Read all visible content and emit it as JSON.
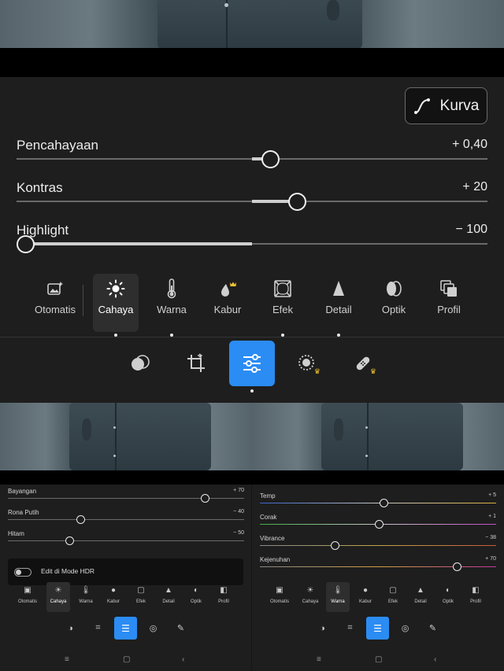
{
  "curve_button": {
    "label": "Kurva",
    "icon": "curve-icon"
  },
  "light_sliders": [
    {
      "label": "Pencahayaan",
      "value": "+ 0,40",
      "position": 0.54
    },
    {
      "label": "Kontras",
      "value": "+ 20",
      "position": 0.6
    },
    {
      "label": "Highlight",
      "value": "− 100",
      "position": 0.0
    }
  ],
  "edit_tabs": [
    {
      "label": "Otomatis",
      "icon": "auto-icon"
    },
    {
      "label": "Cahaya",
      "icon": "sun-icon",
      "active": true
    },
    {
      "label": "Warna",
      "icon": "thermometer-icon"
    },
    {
      "label": "Kabur",
      "icon": "blur-icon"
    },
    {
      "label": "Efek",
      "icon": "vignette-icon"
    },
    {
      "label": "Detail",
      "icon": "detail-icon"
    },
    {
      "label": "Optik",
      "icon": "lens-icon"
    },
    {
      "label": "Profil",
      "icon": "profile-icon"
    }
  ],
  "toolbar": [
    "presets-icon",
    "crop-icon",
    "adjust-icon",
    "masking-icon",
    "healing-icon"
  ],
  "mini_left": {
    "sliders": [
      {
        "label": "Bayangan",
        "value": "+ 70",
        "position": 0.83
      },
      {
        "label": "Rona Putih",
        "value": "− 40",
        "position": 0.3
      },
      {
        "label": "Hitam",
        "value": "− 50",
        "position": 0.25
      }
    ],
    "hdr_label": "Edit di Mode HDR",
    "active_tab": "Cahaya"
  },
  "mini_right": {
    "sliders": [
      {
        "label": "Temp",
        "value": "+ 5",
        "position": 0.52
      },
      {
        "label": "Corak",
        "value": "+ 1",
        "position": 0.5
      },
      {
        "label": "Vibrance",
        "value": "− 38",
        "position": 0.31
      },
      {
        "label": "Kejenuhan",
        "value": "+ 70",
        "position": 0.83
      }
    ],
    "active_tab": "Warna"
  },
  "accent_color": "#2b8cf3",
  "premium_color": "#f2c230"
}
